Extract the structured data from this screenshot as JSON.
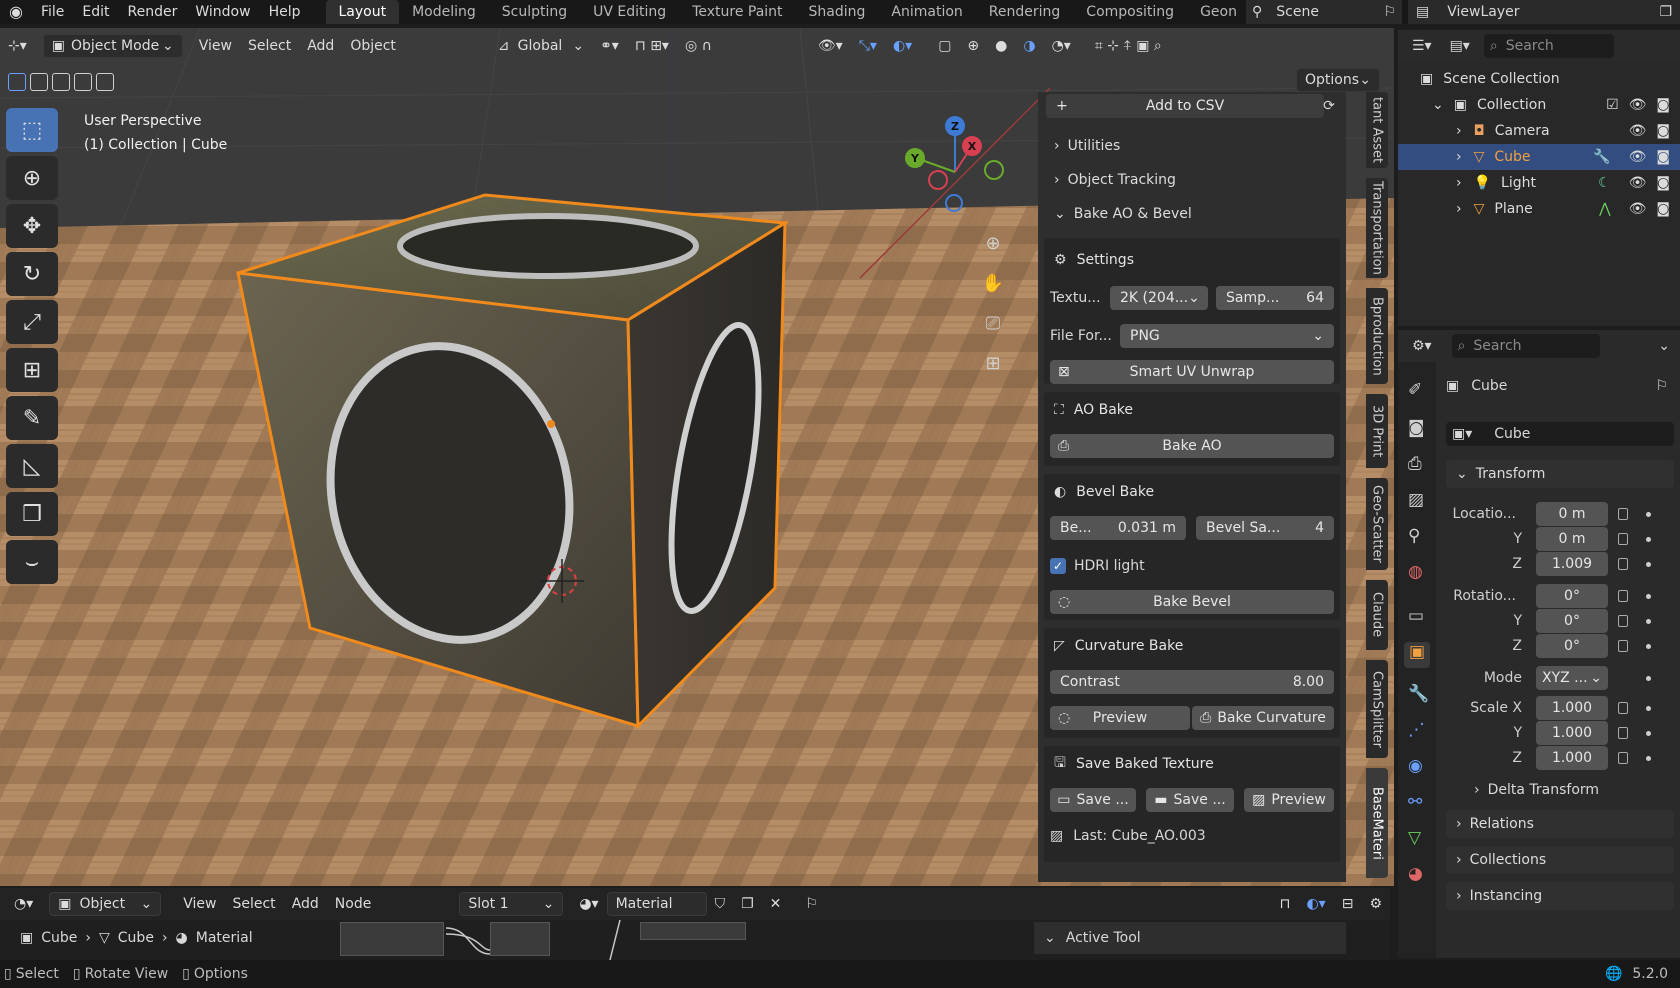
{
  "topbar": {
    "menu": [
      "File",
      "Edit",
      "Render",
      "Window",
      "Help"
    ],
    "workspaces": [
      "Layout",
      "Modeling",
      "Sculpting",
      "UV Editing",
      "Texture Paint",
      "Shading",
      "Animation",
      "Rendering",
      "Compositing",
      "Geon"
    ],
    "active_workspace": "Layout",
    "scene": "Scene",
    "view_layer": "ViewLayer"
  },
  "viewport_header": {
    "mode": "Object Mode",
    "menus": [
      "View",
      "Select",
      "Add",
      "Object"
    ],
    "transform_orientation": "Global",
    "options": "Options"
  },
  "viewport": {
    "perspective": "User Perspective",
    "context": "(1) Collection | Cube",
    "gizmo": {
      "z": "Z",
      "x": "X",
      "y": "Y"
    }
  },
  "npanel": {
    "add_to_csv": "Add to CSV",
    "sections": [
      "Utilities",
      "Object Tracking",
      "Bake AO & Bevel"
    ],
    "settings": {
      "title": "Settings",
      "texture_label": "Textu...",
      "texture_value": "2K (204...",
      "samples_label": "Samp...",
      "samples_value": "64",
      "file_format_label": "File For...",
      "file_format_value": "PNG",
      "smart_uv": "Smart UV Unwrap"
    },
    "ao": {
      "title": "AO Bake",
      "button": "Bake AO"
    },
    "bevel": {
      "title": "Bevel Bake",
      "bevel_label": "Be...",
      "bevel_value": "0.031 m",
      "samples_label": "Bevel Sa...",
      "samples_value": "4",
      "hdri": "HDRI light",
      "button": "Bake Bevel"
    },
    "curvature": {
      "title": "Curvature Bake",
      "contrast_label": "Contrast",
      "contrast_value": "8.00",
      "preview": "Preview",
      "button": "Bake Curvature"
    },
    "save": {
      "title": "Save Baked Texture",
      "save1": "Save ...",
      "save2": "Save ...",
      "preview": "Preview",
      "last": "Last: Cube_AO.003"
    }
  },
  "side_tabs": [
    "tant Asset",
    "Transportation",
    "Bproduction",
    "3D Print",
    "Geo-Scatter",
    "Claude",
    "CamSplitter",
    "BaseMateri"
  ],
  "outliner": {
    "search_placeholder": "Search",
    "scene_collection": "Scene Collection",
    "collection": "Collection",
    "items": [
      "Camera",
      "Cube",
      "Light",
      "Plane"
    ]
  },
  "properties": {
    "search_placeholder": "Search",
    "object_name": "Cube",
    "object_field": "Cube",
    "transform_title": "Transform",
    "location_label": "Locatio...",
    "location": [
      "0 m",
      "0 m",
      "1.009"
    ],
    "rotation_label": "Rotatio...",
    "rotation": [
      "0°",
      "0°",
      "0°"
    ],
    "mode_label": "Mode",
    "mode_value": "XYZ ...",
    "scale_label": "Scale X",
    "scale": [
      "1.000",
      "1.000",
      "1.000"
    ],
    "axis_y": "Y",
    "axis_z": "Z",
    "delta": "Delta Transform",
    "panels": [
      "Relations",
      "Collections",
      "Instancing"
    ]
  },
  "node_header": {
    "editor": "Object",
    "menus": [
      "View",
      "Select",
      "Add",
      "Node"
    ],
    "slot": "Slot 1",
    "material": "Material",
    "breadcrumb": [
      "Cube",
      "Cube",
      "Material"
    ]
  },
  "active_tool": "Active Tool",
  "statusbar": {
    "select": "Select",
    "rotate": "Rotate View",
    "options": "Options",
    "version": "5.2.0"
  }
}
